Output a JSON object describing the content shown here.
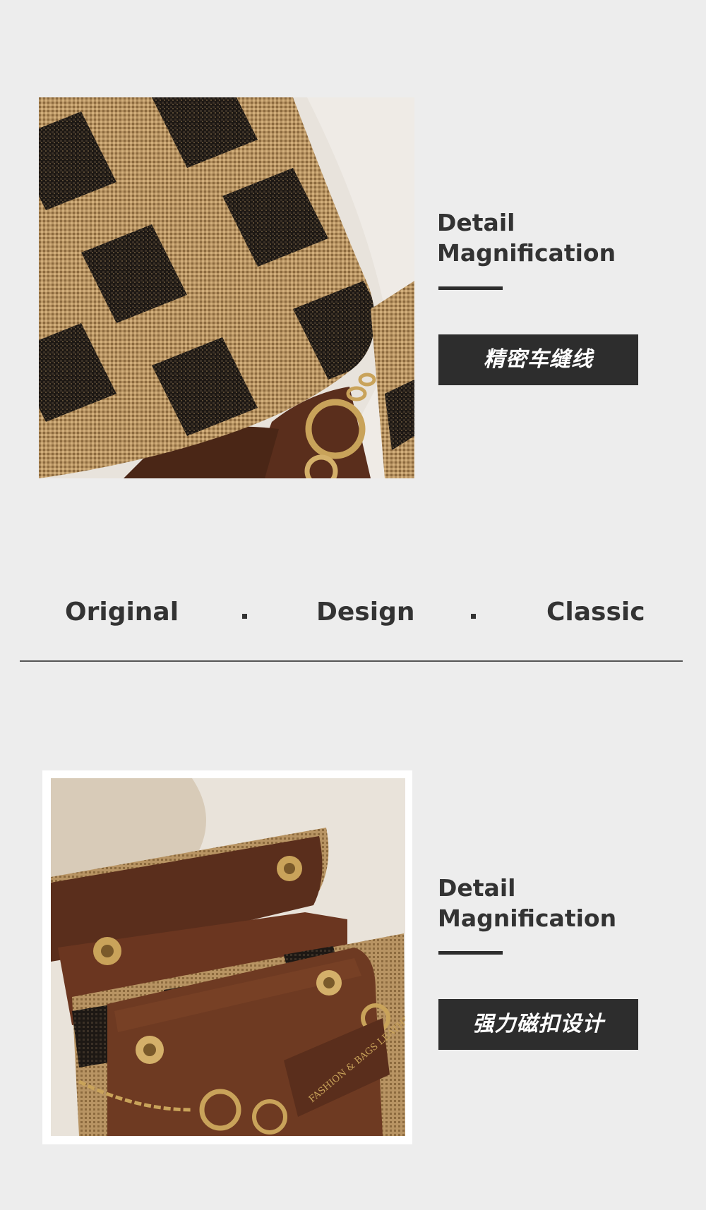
{
  "section1": {
    "heading_line1": "Detail",
    "heading_line2": "Magnification",
    "tag": "精密车缝线",
    "image": "checkered-bag-stitching-closeup-photo"
  },
  "slogan": {
    "word1": "Original",
    "word2": "Design",
    "word3": "Classic"
  },
  "section2": {
    "heading_line1": "Detail",
    "heading_line2": "Magnification",
    "tag": "强力磁扣设计",
    "image": "bag-magnetic-clasp-open-photo",
    "bag_print": "FASHION & BAGS LEATHER"
  },
  "colors": {
    "background": "#ededed",
    "text": "#333333",
    "tag_background": "#2d2d2d",
    "leather_brown": "#5a2e1c",
    "tan": "#b58a55",
    "black_check": "#1f1a14",
    "gold": "#c9a35a"
  }
}
